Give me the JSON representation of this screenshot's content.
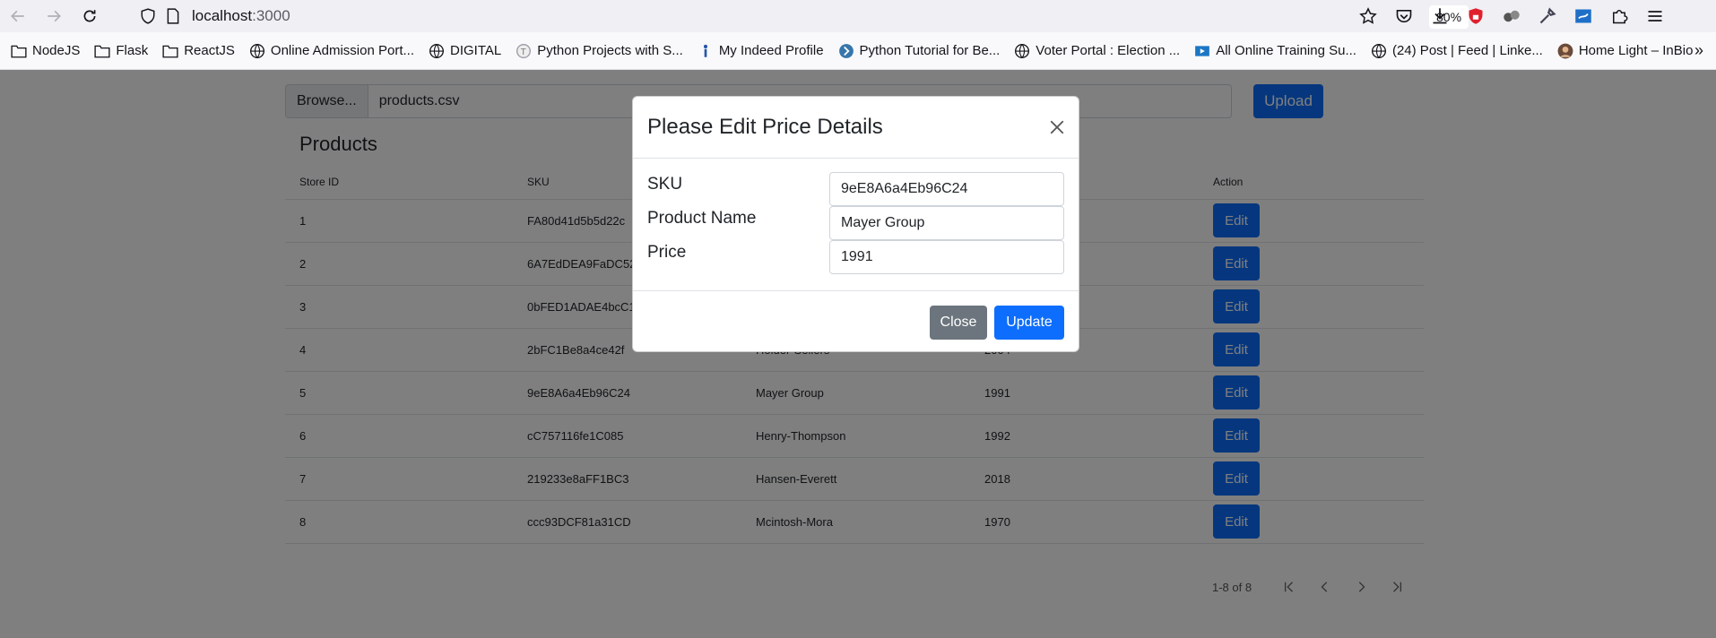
{
  "browser": {
    "url_host": "localhost",
    "url_port": ":3000",
    "zoom": "80%",
    "bookmarks": [
      {
        "label": "NodeJS",
        "icon": "folder-icon"
      },
      {
        "label": "Flask",
        "icon": "folder-icon"
      },
      {
        "label": "ReactJS",
        "icon": "folder-icon"
      },
      {
        "label": "Online Admission Port...",
        "icon": "globe-icon"
      },
      {
        "label": "DIGITAL",
        "icon": "globe-icon"
      },
      {
        "label": "Python Projects with S...",
        "icon": "site-icon"
      },
      {
        "label": "My Indeed Profile",
        "icon": "indeed-icon"
      },
      {
        "label": "Python Tutorial for Be...",
        "icon": "site-icon"
      },
      {
        "label": "Voter Portal : Election ...",
        "icon": "globe-icon"
      },
      {
        "label": "All Online Training Su...",
        "icon": "video-icon"
      },
      {
        "label": "(24) Post | Feed | Linke...",
        "icon": "globe-icon"
      },
      {
        "label": "Home Light – InBio",
        "icon": "avatar-icon"
      }
    ],
    "more_label": "»"
  },
  "upload": {
    "browse_label": "Browse...",
    "file_name": "products.csv",
    "upload_label": "Upload"
  },
  "products": {
    "title": "Products",
    "headers": [
      "Store ID",
      "SKU",
      "",
      "",
      "Action"
    ],
    "rows": [
      {
        "store_id": "1",
        "sku": "FA80d41d5b5d22c",
        "name": "",
        "price": ""
      },
      {
        "store_id": "2",
        "sku": "6A7EdDEA9FaDC52",
        "name": "",
        "price": ""
      },
      {
        "store_id": "3",
        "sku": "0bFED1ADAE4bcC1",
        "name": "",
        "price": ""
      },
      {
        "store_id": "4",
        "sku": "2bFC1Be8a4ce42f",
        "name": "Holder-Sellers",
        "price": "2004"
      },
      {
        "store_id": "5",
        "sku": "9eE8A6a4Eb96C24",
        "name": "Mayer Group",
        "price": "1991"
      },
      {
        "store_id": "6",
        "sku": "cC757116fe1C085",
        "name": "Henry-Thompson",
        "price": "1992"
      },
      {
        "store_id": "7",
        "sku": "219233e8aFF1BC3",
        "name": "Hansen-Everett",
        "price": "2018"
      },
      {
        "store_id": "8",
        "sku": "ccc93DCF81a31CD",
        "name": "Mcintosh-Mora",
        "price": "1970"
      }
    ],
    "edit_label": "Edit",
    "pagination": "1-8 of 8"
  },
  "modal": {
    "title": "Please Edit Price Details",
    "sku_label": "SKU",
    "sku_value": "9eE8A6a4Eb96C24",
    "name_label": "Product Name",
    "name_value": "Mayer Group",
    "price_label": "Price",
    "price_value": "1991",
    "close_label": "Close",
    "update_label": "Update"
  },
  "colors": {
    "primary": "#0d6efd",
    "secondary": "#6c757d",
    "backdrop": "rgba(0,0,0,0.5)"
  }
}
